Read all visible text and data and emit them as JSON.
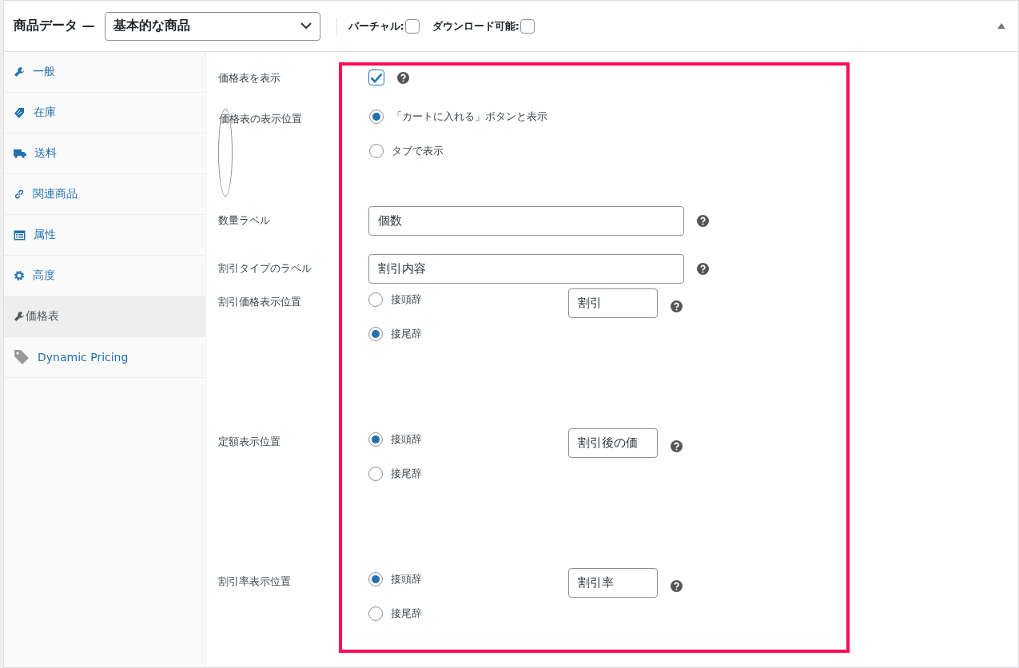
{
  "header": {
    "title": "商品データ —",
    "product_type": "基本的な商品",
    "options": [
      {
        "label": "バーチャル:",
        "checked": false
      },
      {
        "label": "ダウンロード可能:",
        "checked": false
      }
    ]
  },
  "sidebar": {
    "items": [
      {
        "label": "一般",
        "selected": false
      },
      {
        "label": "在庫",
        "selected": false
      },
      {
        "label": "送料",
        "selected": false
      },
      {
        "label": "関連商品",
        "selected": false
      },
      {
        "label": "属性",
        "selected": false
      },
      {
        "label": "高度",
        "selected": false
      },
      {
        "label": "価格表",
        "selected": true
      },
      {
        "label": "Dynamic Pricing",
        "selected": false
      }
    ]
  },
  "fields": [
    {
      "kind": "checkbox",
      "label": "価格表を表示",
      "checked": true,
      "help": true
    },
    {
      "kind": "radio",
      "label": "価格表の表示位置",
      "help": false,
      "options": [
        {
          "label": "「カートに入れる」ボタンと表示",
          "selected": true
        },
        {
          "label": "タブで表示",
          "selected": false
        }
      ]
    },
    {
      "kind": "text",
      "label": "数量ラベル",
      "value": "個数",
      "help": true
    },
    {
      "kind": "text",
      "label": "割引タイプのラベル",
      "value": "割引内容",
      "help": true
    },
    {
      "kind": "radio_text",
      "label": "割引価格表示位置",
      "help": true,
      "value": "割引",
      "options": [
        {
          "label": "接頭辞",
          "selected": false
        },
        {
          "label": "接尾辞",
          "selected": true
        }
      ]
    },
    {
      "kind": "radio_text",
      "label": "定額表示位置",
      "help": true,
      "value": "割引後の価",
      "options": [
        {
          "label": "接頭辞",
          "selected": true
        },
        {
          "label": "接尾辞",
          "selected": false
        }
      ]
    },
    {
      "kind": "radio_text",
      "label": "割引率表示位置",
      "help": true,
      "value": "割引率",
      "options": [
        {
          "label": "接頭辞",
          "selected": true
        },
        {
          "label": "接尾辞",
          "selected": false
        }
      ]
    }
  ]
}
